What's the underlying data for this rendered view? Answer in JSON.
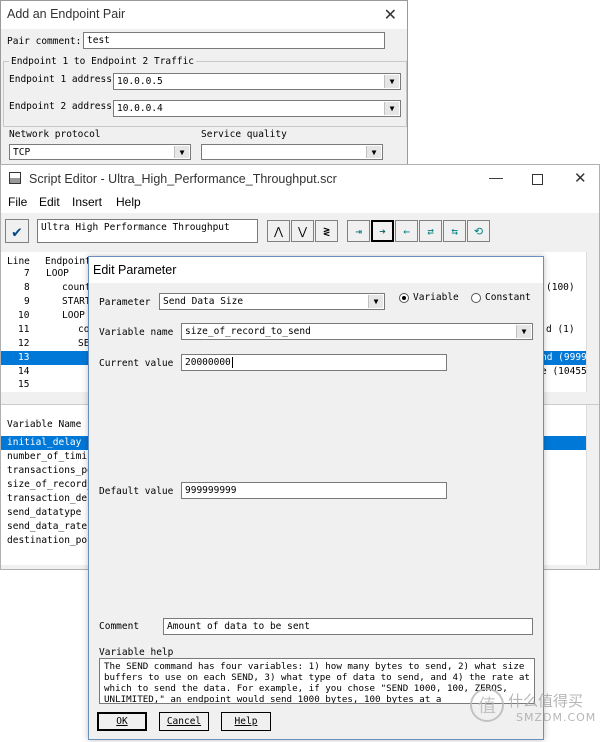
{
  "endpoint_dialog": {
    "title": "Add an Endpoint Pair",
    "pair_comment_label": "Pair comment:",
    "pair_comment_value": "test",
    "group_label": "Endpoint 1 to Endpoint 2 Traffic",
    "ep1_label": "Endpoint 1 address",
    "ep1_value": "10.0.0.5",
    "ep2_label": "Endpoint 2 address",
    "ep2_value": "10.0.0.4",
    "protocol_label": "Network protocol",
    "protocol_value": "TCP",
    "quality_label": "Service quality",
    "quality_value": ""
  },
  "script_editor": {
    "title": "Script Editor - Ultra_High_Performance_Throughput.scr",
    "menu": [
      "File",
      "Edit",
      "Insert",
      "Help"
    ],
    "script_name": "Ultra High Performance Throughput",
    "col_line": "Line",
    "col_endpoint": "Endpoint",
    "lines": [
      {
        "num": "7",
        "text": "LOOP",
        "right": ""
      },
      {
        "num": "8",
        "text": "count",
        "right": "(100)"
      },
      {
        "num": "9",
        "text": "START",
        "right": ""
      },
      {
        "num": "10",
        "text": "LOOP",
        "right": ""
      },
      {
        "num": "11",
        "text": "co",
        "right": "d (1)"
      },
      {
        "num": "12",
        "text": "SE",
        "right": ""
      },
      {
        "num": "13",
        "text": "",
        "right": "nd (9999"
      },
      {
        "num": "14",
        "text": "",
        "right": "e (10455"
      },
      {
        "num": "15",
        "text": "",
        "right": ""
      }
    ],
    "var_header": "Variable Name",
    "variables": [
      "initial_delay",
      "number_of_timin",
      "transactions_pe",
      "size_of_record_",
      "transaction_del",
      "send_datatype",
      "send_data_rate",
      "destination_por"
    ]
  },
  "edit_param": {
    "title": "Edit Parameter",
    "parameter_label": "Parameter",
    "parameter_value": "Send Data Size",
    "radio_variable": "Variable",
    "radio_constant": "Constant",
    "varname_label": "Variable name",
    "varname_value": "size_of_record_to_send",
    "current_label": "Current value",
    "current_value": "20000000",
    "default_label": "Default value",
    "default_value": "999999999",
    "comment_label": "Comment",
    "comment_value": "Amount of data to be sent",
    "help_label": "Variable help",
    "help_text": "The SEND command has four variables: 1) how many bytes to send, 2) what size buffers to use on each SEND, 3) what type of data to send, and 4) the rate at which to send the data. For example, if you chose \"SEND 1000, 100, ZEROS, UNLIMITED,\" an endpoint would send 1000 bytes, 100 bytes at a",
    "ok": "OK",
    "cancel": "Cancel",
    "help": "Help"
  },
  "watermark": {
    "text": "什么值得买",
    "subtext": "SMZDM.COM"
  }
}
